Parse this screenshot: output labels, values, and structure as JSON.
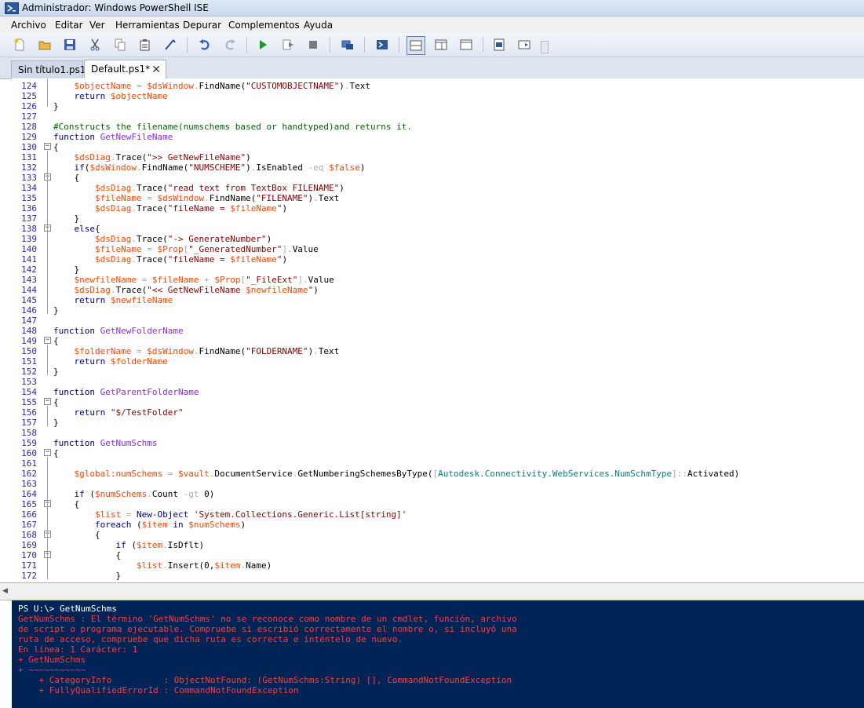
{
  "window": {
    "title": "Administrador: Windows PowerShell ISE"
  },
  "menu": [
    "Archivo",
    "Editar",
    "Ver",
    "Herramientas",
    "Depurar",
    "Complementos",
    "Ayuda"
  ],
  "toolbar": {
    "icons": [
      "new-file-icon",
      "open-file-icon",
      "save-icon",
      "cut-icon",
      "copy-icon",
      "paste-icon",
      "clear-console-icon",
      "undo-icon",
      "redo-icon",
      "run-icon",
      "run-selection-icon",
      "stop-icon",
      "remote-powershell-icon",
      "powershell-console-icon",
      "show-script-top-icon",
      "show-script-right-icon",
      "show-script-maximized-icon",
      "show-command-icon",
      "show-addon-icon"
    ]
  },
  "tabs": [
    {
      "label": "Sin título1.ps1",
      "active": false
    },
    {
      "label": "Default.ps1*",
      "active": true,
      "close": "✕"
    }
  ],
  "editor": {
    "lines": [
      {
        "n": "124",
        "code": "    $objectName = $dsWindow.FindName(\"CUSTOMOBJECTNAME\").Text"
      },
      {
        "n": "125",
        "code": "    return $objectName"
      },
      {
        "n": "126",
        "code": "}"
      },
      {
        "n": "127",
        "code": ""
      },
      {
        "n": "128",
        "code": "#Constructs the filename(numschems based or handtyped)and returns it."
      },
      {
        "n": "129",
        "code": "function GetNewFileName"
      },
      {
        "n": "130",
        "code": "{"
      },
      {
        "n": "131",
        "code": "    $dsDiag.Trace(\">> GetNewFileName\")"
      },
      {
        "n": "132",
        "code": "    if($dsWindow.FindName(\"NUMSCHEME\").IsEnabled -eq $false)"
      },
      {
        "n": "133",
        "code": "    {"
      },
      {
        "n": "134",
        "code": "        $dsDiag.Trace(\"read text from TextBox FILENAME\")"
      },
      {
        "n": "135",
        "code": "        $fileName = $dsWindow.FindName(\"FILENAME\").Text"
      },
      {
        "n": "136",
        "code": "        $dsDiag.Trace(\"fileName = $fileName\")"
      },
      {
        "n": "137",
        "code": "    }"
      },
      {
        "n": "138",
        "code": "    else{"
      },
      {
        "n": "139",
        "code": "        $dsDiag.Trace(\"-> GenerateNumber\")"
      },
      {
        "n": "140",
        "code": "        $fileName = $Prop[\"_GeneratedNumber\"].Value"
      },
      {
        "n": "141",
        "code": "        $dsDiag.Trace(\"fileName = $fileName\")"
      },
      {
        "n": "142",
        "code": "    }"
      },
      {
        "n": "143",
        "code": "    $newfileName = $fileName + $Prop[\"_FileExt\"].Value"
      },
      {
        "n": "144",
        "code": "    $dsDiag.Trace(\"<< GetNewFileName $newfileName\")"
      },
      {
        "n": "145",
        "code": "    return $newfileName"
      },
      {
        "n": "146",
        "code": "}"
      },
      {
        "n": "147",
        "code": ""
      },
      {
        "n": "148",
        "code": "function GetNewFolderName"
      },
      {
        "n": "149",
        "code": "{"
      },
      {
        "n": "150",
        "code": "    $folderName = $dsWindow.FindName(\"FOLDERNAME\").Text"
      },
      {
        "n": "151",
        "code": "    return $folderName"
      },
      {
        "n": "152",
        "code": "}"
      },
      {
        "n": "153",
        "code": ""
      },
      {
        "n": "154",
        "code": "function GetParentFolderName"
      },
      {
        "n": "155",
        "code": "{"
      },
      {
        "n": "156",
        "code": "    return \"$/TestFolder\""
      },
      {
        "n": "157",
        "code": "}"
      },
      {
        "n": "158",
        "code": ""
      },
      {
        "n": "159",
        "code": "function GetNumSchms"
      },
      {
        "n": "160",
        "code": "{"
      },
      {
        "n": "161",
        "code": ""
      },
      {
        "n": "162",
        "code": "    $global:numSchems = $vault.DocumentService.GetNumberingSchemesByType([Autodesk.Connectivity.WebServices.NumSchmType]::Activated)"
      },
      {
        "n": "163",
        "code": ""
      },
      {
        "n": "164",
        "code": "    if ($numSchems.Count -gt 0)"
      },
      {
        "n": "165",
        "code": "    {"
      },
      {
        "n": "166",
        "code": "        $list = New-Object 'System.Collections.Generic.List[string]'"
      },
      {
        "n": "167",
        "code": "        foreach ($item in $numSchems)"
      },
      {
        "n": "168",
        "code": "        {"
      },
      {
        "n": "169",
        "code": "            if ($item.IsDflt)"
      },
      {
        "n": "170",
        "code": "            {"
      },
      {
        "n": "171",
        "code": "                $list.Insert(0,$item.Name)"
      },
      {
        "n": "172",
        "code": "            }"
      }
    ]
  },
  "console": {
    "lines": [
      {
        "text": "PS U:\\> GetNumSchms",
        "color": "white"
      },
      {
        "text": "GetNumSchms : El término 'GetNumSchms' no se reconoce como nombre de un cmdlet, función, archivo",
        "color": "red"
      },
      {
        "text": "de script o programa ejecutable. Compruebe si escribió correctamente el nombre o, si incluyó una",
        "color": "red"
      },
      {
        "text": "ruta de acceso, compruebe que dicha ruta es correcta e inténtelo de nuevo.",
        "color": "red"
      },
      {
        "text": "En línea: 1 Carácter: 1",
        "color": "red"
      },
      {
        "text": "+ GetNumSchms",
        "color": "red"
      },
      {
        "text": "+ ~~~~~~~~~~~",
        "color": "red"
      },
      {
        "text": "    + CategoryInfo          : ObjectNotFound: (GetNumSchms:String) [], CommandNotFoundException",
        "color": "red"
      },
      {
        "text": "    + FullyQualifiedErrorId : CommandNotFoundException",
        "color": "red"
      }
    ]
  },
  "colors": {
    "console_bg": "#012456",
    "error_text": "#ff3c3c",
    "line_numbers": "#2a2aa8"
  }
}
